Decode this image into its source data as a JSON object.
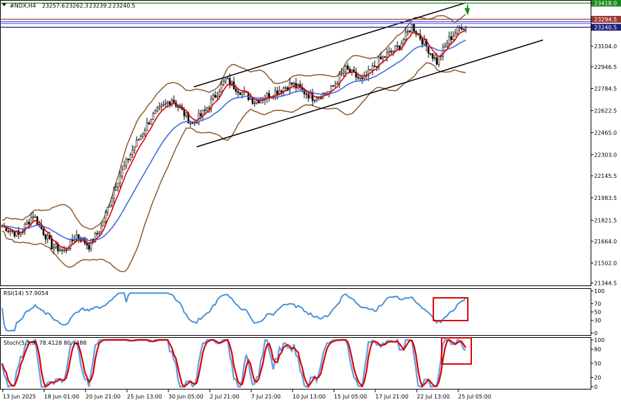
{
  "chart_data": [
    {
      "type": "candlestick",
      "symbol_header": "#NDX,H4",
      "ohlc_header": [
        "23257.6",
        "23262.3",
        "23239.2",
        "23240.5"
      ],
      "y_ticks": [
        "23418.0",
        "23294.5",
        "23240.5",
        "23104.0",
        "22946.5",
        "22784.5",
        "22622.5",
        "22465.0",
        "22303.0",
        "22145.5",
        "21983.5",
        "21821.5",
        "21664.0",
        "21502.0",
        "21344.5"
      ],
      "ylim": [
        21330,
        23440
      ],
      "price_marks": [
        {
          "label": "23418.0",
          "value": 23418.0,
          "color": "#1a8a1a"
        },
        {
          "label": "23294.5",
          "value": 23294.5,
          "color": "#9b3a32"
        },
        {
          "label": "23240.5",
          "value": 23240.5,
          "color": "#1f1f7a"
        }
      ],
      "colors": {
        "ma_fast": "#e00000",
        "ma_slow": "#4169e1",
        "bollinger": "#8b5a2b",
        "channel": "#000000",
        "arrow": "#1a8a1a"
      }
    },
    {
      "type": "line",
      "title": "RSI(14) 57.9054",
      "y_ticks": [
        "100",
        "70",
        "50",
        "30",
        "0"
      ],
      "ylim": [
        0,
        100
      ],
      "color": "#4a90d9"
    },
    {
      "type": "line",
      "title": "Stoch(5,3,3) 78.4128 80.7488",
      "y_ticks": [
        "100",
        "80",
        "50",
        "20",
        "0"
      ],
      "ylim": [
        0,
        100
      ],
      "series_colors": [
        "#6a9fe0",
        "#dd0000"
      ]
    }
  ],
  "x_axis_labels": [
    "13 Jun 2025",
    "18 Jun 01:00",
    "20 Jun 21:00",
    "25 Jun 13:00",
    "30 Jun 05:00",
    "2 Jul 21:00",
    "7 Jul 21:00",
    "10 Jul 13:00",
    "15 Jul 05:00",
    "17 Jul 21:00",
    "22 Jul 13:00",
    "25 Jul 05:00"
  ]
}
